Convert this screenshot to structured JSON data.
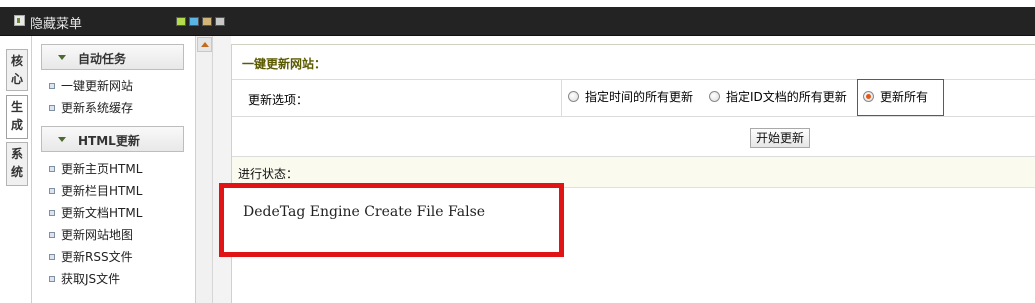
{
  "topbar": {
    "menu_label": "隐藏菜单",
    "swatch_colors": [
      "#b4dc4a",
      "#5ab4e6",
      "#d2b478",
      "#c8c8c8"
    ]
  },
  "vtabs": [
    {
      "label": [
        "核",
        "心"
      ],
      "active": false
    },
    {
      "label": [
        "生",
        "成"
      ],
      "active": true
    },
    {
      "label": [
        "系",
        "统"
      ],
      "active": false
    }
  ],
  "sidebar": {
    "groups": [
      {
        "title": "自动任务",
        "items": [
          "一键更新网站",
          "更新系统缓存"
        ]
      },
      {
        "title": "HTML更新",
        "items": [
          "更新主页HTML",
          "更新栏目HTML",
          "更新文档HTML",
          "更新网站地图",
          "更新RSS文件",
          "获取JS文件"
        ]
      }
    ]
  },
  "panel": {
    "title": "一键更新网站：",
    "option_label": "更新选项：",
    "options": [
      "指定时间的所有更新",
      "指定ID文档的所有更新",
      "更新所有"
    ],
    "selected_option": "更新所有",
    "start_button": "开始更新",
    "status_label": "进行状态：",
    "status_text": "DedeTag Engine Create File False"
  },
  "colors": {
    "topbar_bg": "#232323",
    "highlight_red": "#e01414",
    "radio_selected": "#e05a1a"
  }
}
